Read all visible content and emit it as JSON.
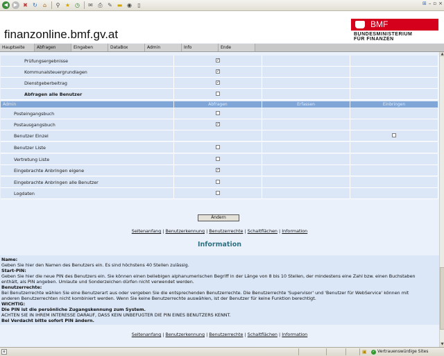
{
  "browser": {
    "toolbar_icons": [
      "back-icon",
      "forward-icon",
      "stop-icon",
      "refresh-icon",
      "home-icon",
      "search-icon",
      "favorites-icon",
      "history-icon",
      "mail-icon",
      "print-icon",
      "edit-icon",
      "folder-icon",
      "messenger-icon",
      "discuss-icon"
    ],
    "window_controls": [
      "–",
      "▫",
      "×"
    ]
  },
  "header": {
    "site_title": "finanzonline.bmf.gv.at",
    "logo_text": "BMF",
    "ministry_line1": "BUNDESMINISTERIUM",
    "ministry_line2": "FÜR FINANZEN",
    "brand_color": "#d5001c"
  },
  "nav": {
    "items": [
      "Hauptseite",
      "Abfragen",
      "Eingaben",
      "DataBox",
      "Admin",
      "Info",
      "Ende"
    ]
  },
  "abfragen_rows": [
    {
      "label": "Prüfungsergebnisse",
      "checked": true,
      "bold": false
    },
    {
      "label": "Kommunalsteuergrundlagen",
      "checked": true,
      "bold": false
    },
    {
      "label": "Dienstgeberbeitrag",
      "checked": true,
      "bold": false
    },
    {
      "label": "Abfragen alle Benutzer",
      "checked": false,
      "bold": true
    }
  ],
  "section_header": {
    "col1": "Admin",
    "col2": "Abfragen",
    "col3": "Erfassen",
    "col4": "Einbringen"
  },
  "admin_rows": [
    {
      "label": "Posteingangsbuch",
      "abfragen": false,
      "einbringen": null
    },
    {
      "label": "Postausgangsbuch",
      "abfragen": true,
      "einbringen": null
    },
    {
      "label": "Benutzer Einzel",
      "abfragen": null,
      "einbringen": false
    },
    {
      "label": "Benutzer Liste",
      "abfragen": false,
      "einbringen": null
    },
    {
      "label": "Vertretung Liste",
      "abfragen": false,
      "einbringen": null
    },
    {
      "label": "Eingebrachte Anbringen eigene",
      "abfragen": true,
      "einbringen": null
    },
    {
      "label": "Eingebrachte Anbringen alle Benutzer",
      "abfragen": false,
      "einbringen": null
    },
    {
      "label": "Logdaten",
      "abfragen": false,
      "einbringen": null
    }
  ],
  "submit_button": "Ändern",
  "links": [
    "Seitenanfang",
    "Benutzerkennung",
    "Benutzerrechte",
    "Schaltflächen",
    "Information"
  ],
  "link_separator": "|",
  "information": {
    "title": "Information",
    "lines": [
      {
        "text": "Name:",
        "bold": true
      },
      {
        "text": "Geben Sie hier den Namen des Benutzers ein. Es sind höchstens 40 Stellen zulässig.",
        "bold": false
      },
      {
        "text": "Start-PIN:",
        "bold": true
      },
      {
        "text": "Geben Sie hier die neue PIN des Benutzers ein. Sie können einen beliebigen alphanumerischen Begriff in der Länge von 8 bis 10 Stellen, der mindestens eine Zahl bzw. einen Buchstaben",
        "bold": false
      },
      {
        "text": "enthält, als PIN angeben. Umlaute und Sonderzeichen dürfen nicht verwendet werden.",
        "bold": false
      },
      {
        "text": "Benutzerrechte:",
        "bold": true
      },
      {
        "text": "Bei Benutzerrechte wählen Sie eine Benutzerart aus oder vergeben Sie die entsprechenden Benutzerrechte. Die Benutzerrechte 'Supervisor' und 'Benutzer für WebService' können mit",
        "bold": false
      },
      {
        "text": "anderen Benutzerrechten nicht kombiniert werden. Wenn Sie keine Benutzerrechte auswählen, ist der Benutzer für keine Funktion berechtigt.",
        "bold": false
      },
      {
        "text": "WICHTIG:",
        "bold": true
      },
      {
        "text": "Die PIN ist die persönliche Zugangskennung zum System.",
        "bold": true
      },
      {
        "text": "ACHTEN SIE IN IHREM INTERESSE DARAUF, DASS KEIN UNBEFUGTER DIE PIN EINES BENUTZERS KENNT.",
        "bold": false
      },
      {
        "text": "Bei Verdacht bitte sofort PIN ändern.",
        "bold": true
      }
    ]
  },
  "status": {
    "trusted_sites": "Vertrauenswürdige Sites"
  }
}
